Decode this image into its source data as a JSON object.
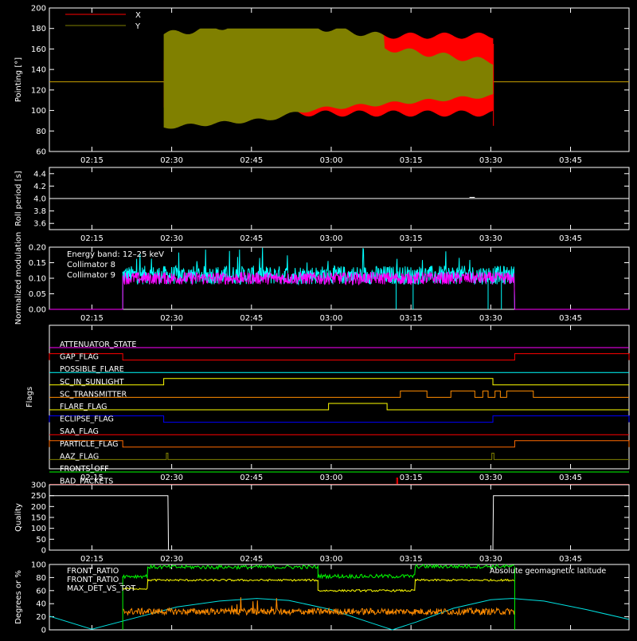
{
  "time_axis": {
    "range_minutes": [
      127,
      236
    ],
    "ticks": [
      {
        "m": 135,
        "label": "02:15"
      },
      {
        "m": 150,
        "label": "02:30"
      },
      {
        "m": 165,
        "label": "02:45"
      },
      {
        "m": 180,
        "label": "03:00"
      },
      {
        "m": 195,
        "label": "03:15"
      },
      {
        "m": 210,
        "label": "03:30"
      },
      {
        "m": 225,
        "label": "03:45"
      }
    ]
  },
  "chart_data": [
    {
      "type": "area",
      "ylabel": "Pointing [°]",
      "ylim": [
        60,
        200
      ],
      "yticks": [
        60,
        80,
        100,
        120,
        140,
        160,
        180,
        200
      ],
      "legend": {
        "placement": "top-left"
      },
      "series": [
        {
          "name": "X",
          "color": "#ff0000",
          "active_range": [
            148.5,
            210.5
          ],
          "baseline": 128
        },
        {
          "name": "Y",
          "color": "#808000",
          "active_range": [
            148.5,
            210.5
          ],
          "baseline": 128
        }
      ]
    },
    {
      "type": "line",
      "ylabel": "Roll period [s]",
      "ylim": [
        3.5,
        4.5
      ],
      "yticks": [
        3.6,
        3.8,
        4.0,
        4.2,
        4.4
      ],
      "series": [
        {
          "name": "",
          "color": "#ffffff",
          "value": 4.0
        }
      ]
    },
    {
      "type": "line",
      "ylabel": "Normalized modulation",
      "ylim": [
        0,
        0.2
      ],
      "yticks": [
        0.0,
        0.05,
        0.1,
        0.15,
        0.2
      ],
      "legend": {
        "placement": "top-left"
      },
      "series": [
        {
          "name": "Collimator 8",
          "color": "#00ffff",
          "active_range": [
            140.8,
            214.5
          ],
          "mean": 0.11
        },
        {
          "name": "Collimator 9",
          "color": "#ff00ff",
          "active_range": [
            140.8,
            214.5
          ],
          "mean": 0.1
        }
      ]
    },
    {
      "type": "line",
      "ylabel": "Flags",
      "flags": [
        {
          "name": "ATTENUATOR_STATE",
          "color": "#ff00ff",
          "segments": []
        },
        {
          "name": "GAP_FLAG",
          "color": "#ff0000",
          "segments": [
            [
              127,
              140.8
            ],
            [
              214.5,
              236
            ]
          ]
        },
        {
          "name": "POSSIBLE_FLARE",
          "color": "#00ffff",
          "segments": []
        },
        {
          "name": "SC_IN_SUNLIGHT",
          "color": "#ffff00",
          "segments": [
            [
              148.5,
              210.4
            ]
          ]
        },
        {
          "name": "SC_TRANSMITTER",
          "color": "#ff8c00",
          "segments": [
            [
              193,
              198
            ],
            [
              202.5,
              207
            ],
            [
              208.5,
              209.5
            ],
            [
              210.8,
              211.8
            ],
            [
              213,
              218
            ]
          ]
        },
        {
          "name": "FLARE_FLAG",
          "color": "#ffff00",
          "segments": [
            [
              179.5,
              190.5
            ]
          ]
        },
        {
          "name": "ECLIPSE_FLAG",
          "color": "#0000ff",
          "segments": [
            [
              127,
              148.5
            ],
            [
              210.4,
              236
            ]
          ]
        },
        {
          "name": "SAA_FLAG",
          "color": "#ff0000",
          "segments": []
        },
        {
          "name": "PARTICLE_FLAG",
          "color": "#ff6a00",
          "segments": [
            [
              127,
              140.8
            ],
            [
              214.5,
              236
            ]
          ]
        },
        {
          "name": "AAZ_FLAG",
          "color": "#808000",
          "segments": [
            [
              149,
              149.3
            ],
            [
              210.2,
              210.6
            ]
          ]
        },
        {
          "name": "FRONTS_OFF",
          "color": "#00ff00",
          "segments": []
        },
        {
          "name": "BAD_PACKETS",
          "color": "#ff0000",
          "segments": [
            [
              192.3,
              192.5
            ]
          ]
        }
      ]
    },
    {
      "type": "line",
      "ylabel": "Quality",
      "ylim": [
        0,
        300
      ],
      "yticks": [
        0,
        50,
        100,
        150,
        200,
        250,
        300
      ],
      "series": [
        {
          "name": "",
          "color": "#ffffff",
          "points": [
            [
              127,
              250
            ],
            [
              149.3,
              250
            ],
            [
              149.4,
              0
            ],
            [
              210.4,
              0
            ],
            [
              210.5,
              250
            ],
            [
              236,
              250
            ]
          ]
        }
      ]
    },
    {
      "type": "line",
      "ylabel": "Degrees or %",
      "ylim": [
        0,
        100
      ],
      "yticks": [
        0,
        20,
        40,
        60,
        80,
        100
      ],
      "legend": {
        "placement": "top-left"
      },
      "series": [
        {
          "name": "FRONT_RATIO",
          "color": "#ffff00",
          "points": [
            [
              140.8,
              63
            ],
            [
              145.5,
              63
            ],
            [
              145.5,
              76
            ],
            [
              177.5,
              76
            ],
            [
              177.5,
              60
            ],
            [
              195.8,
              60
            ],
            [
              195.8,
              76
            ],
            [
              214.5,
              76
            ]
          ]
        },
        {
          "name": "FRONT_RATIO_",
          "color": "#00ff00",
          "points": [
            [
              140.8,
              82
            ],
            [
              145.5,
              82
            ],
            [
              145.5,
              96
            ],
            [
              177.5,
              96
            ],
            [
              177.5,
              82
            ],
            [
              195.8,
              82
            ],
            [
              195.8,
              97
            ],
            [
              214.5,
              97
            ]
          ]
        },
        {
          "name": "MAX_DET_VS_TOT",
          "color": "#ff8c00",
          "mean": 28,
          "active_range": [
            140.8,
            214.5
          ]
        },
        {
          "name": "Absolute geomagnetic latitude",
          "color": "#00e0e0",
          "points": [
            [
              127,
              21
            ],
            [
              135,
              1
            ],
            [
              143,
              18
            ],
            [
              151,
              35
            ],
            [
              159,
              44
            ],
            [
              166,
              48
            ],
            [
              172,
              45
            ],
            [
              180,
              31
            ],
            [
              187,
              12
            ],
            [
              191.5,
              0
            ],
            [
              196,
              12
            ],
            [
              203,
              33
            ],
            [
              210,
              46
            ],
            [
              214,
              48
            ],
            [
              220,
              44
            ],
            [
              228,
              31
            ],
            [
              236,
              16
            ]
          ]
        }
      ]
    }
  ],
  "annotations": {
    "energy_band": "Energy band: 12–25 keV"
  }
}
